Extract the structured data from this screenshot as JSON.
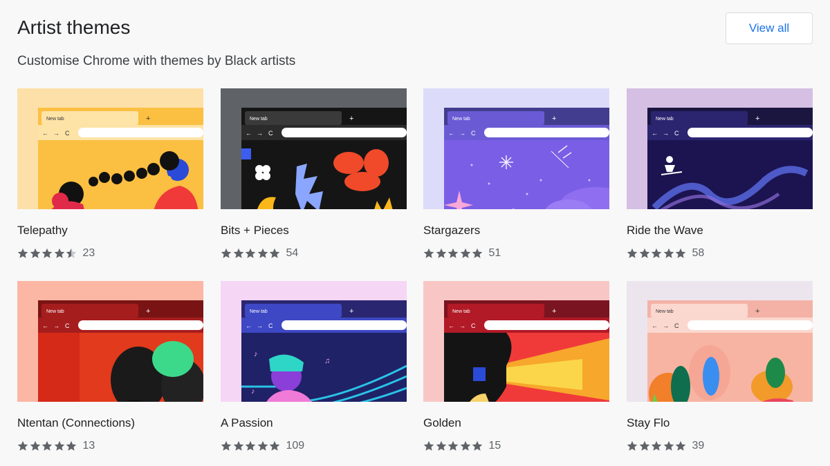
{
  "header": {
    "title": "Artist themes",
    "subtitle": "Customise Chrome with themes by Black artists",
    "view_all_label": "View all"
  },
  "browser_mock": {
    "tab_label": "New tab",
    "new_tab_glyph": "+",
    "back_glyph": "←",
    "forward_glyph": "→",
    "reload_glyph": "C"
  },
  "themes": [
    {
      "name": "Telepathy",
      "rating": 4.5,
      "count": "23",
      "colors": {
        "bg": "#fde0a8",
        "frame": "#fbbf42",
        "tab": "#fde3a6",
        "toolbar": "#fde3a6",
        "art": "#fbbf42"
      }
    },
    {
      "name": "Bits + Pieces",
      "rating": 5,
      "count": "54",
      "colors": {
        "bg": "#5f6368",
        "frame": "#151515",
        "tab": "#3a3a3a",
        "toolbar": "#2b2b2b",
        "art": "#151515"
      }
    },
    {
      "name": "Stargazers",
      "rating": 5,
      "count": "51",
      "colors": {
        "bg": "#dcdcfa",
        "frame": "#433d8f",
        "tab": "#6a5bd4",
        "toolbar": "#6a5bd4",
        "art": "#7b5ee6"
      }
    },
    {
      "name": "Ride the Wave",
      "rating": 5,
      "count": "58",
      "colors": {
        "bg": "#d5bfe3",
        "frame": "#1a1640",
        "tab": "#2b2570",
        "toolbar": "#2b2570",
        "art": "#1c1450"
      }
    },
    {
      "name": "Ntentan (Connections)",
      "rating": 5,
      "count": "13",
      "colors": {
        "bg": "#fbb7a4",
        "frame": "#7a1414",
        "tab": "#a61d1d",
        "toolbar": "#a61d1d",
        "art": "#e23a1c"
      }
    },
    {
      "name": "A Passion",
      "rating": 5,
      "count": "109",
      "colors": {
        "bg": "#f6d6f5",
        "frame": "#2a2770",
        "tab": "#3e48c4",
        "toolbar": "#3e48c4",
        "art": "#1f2266"
      }
    },
    {
      "name": "Golden",
      "rating": 5,
      "count": "15",
      "colors": {
        "bg": "#f9c6c6",
        "frame": "#7a1420",
        "tab": "#b11a26",
        "toolbar": "#b11a26",
        "art": "#f03a3a"
      }
    },
    {
      "name": "Stay Flo",
      "rating": 5,
      "count": "39",
      "colors": {
        "bg": "#ece5ee",
        "frame": "#f4b2a6",
        "tab": "#fbd8cf",
        "toolbar": "#fbd8cf",
        "art": "#f7b4a2"
      }
    }
  ]
}
